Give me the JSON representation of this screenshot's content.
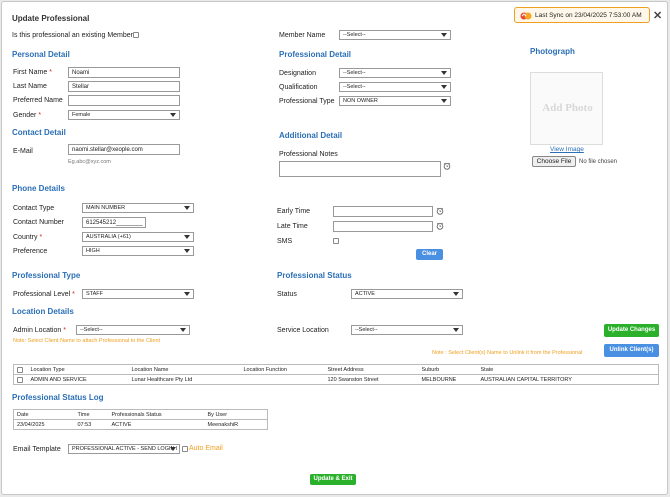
{
  "dialog": {
    "title": "Update Professional",
    "sync_text": "Last Sync on 23/04/2025 7:53:00 AM"
  },
  "existing_member": {
    "label": "Is this professional an existing Member?"
  },
  "member_name": {
    "label": "Member Name",
    "value": "--Select--"
  },
  "personal": {
    "heading": "Personal Detail",
    "first_name_label": "First Name",
    "first_name": "Noami",
    "last_name_label": "Last Name",
    "last_name": "Stellar",
    "preferred_name_label": "Preferred Name",
    "preferred_name": "",
    "gender_label": "Gender",
    "gender": "Female"
  },
  "contact": {
    "heading": "Contact Detail",
    "email_label": "E-Mail",
    "email": "naomi.stellar@xeople.com",
    "email_hint": "Eg.abc@xyz.com"
  },
  "professional": {
    "heading": "Professional Detail",
    "designation_label": "Designation",
    "designation": "--Select--",
    "qualification_label": "Qualification",
    "qualification": "--Select--",
    "type_label": "Professional Type",
    "type": "NON OWNER"
  },
  "photo": {
    "heading": "Photograph",
    "placeholder": "Add Photo",
    "view_link": "View Image",
    "choose_button": "Choose File",
    "no_file": "No file chosen"
  },
  "additional": {
    "heading": "Additional Detail",
    "notes_label": "Professional Notes",
    "notes": ""
  },
  "phone": {
    "heading": "Phone Details",
    "contact_type_label": "Contact Type",
    "contact_type": "MAIN NUMBER",
    "contact_number_label": "Contact Number",
    "contact_number": "612545212________",
    "country_label": "Country",
    "country": "AUSTRALIA (+61)",
    "preference_label": "Preference",
    "preference": "HIGH"
  },
  "timing": {
    "early_time_label": "Early Time",
    "early_time": "",
    "late_time_label": "Late Time",
    "late_time": "",
    "sms_label": "SMS",
    "clear_button": "Clear"
  },
  "prof_type": {
    "heading": "Professional Type",
    "level_label": "Professional Level",
    "level": "STAFF"
  },
  "prof_status": {
    "heading": "Professional Status",
    "status_label": "Status",
    "status": "ACTIVE"
  },
  "location": {
    "heading": "Location Details",
    "admin_label": "Admin Location",
    "admin_value": "--Select--",
    "service_label": "Service Location",
    "service_value": "--Select--",
    "admin_note": "Note: Select Client Name to attach Professional to the Client",
    "unlink_note": "Note : Select Client(s) Name to Unlink it from the Professional",
    "update_button": "Update Changes",
    "unlink_button": "Unlink Client(s)",
    "columns": [
      "Location Type",
      "Location Name",
      "Location Function",
      "Street Address",
      "Suburb",
      "State"
    ],
    "rows": [
      [
        "ADMIN AND SERVICE",
        "Lunar Healthcare Pty Ltd",
        "",
        "120 Swanston Street",
        "MELBOURNE",
        "AUSTRALIAN CAPITAL TERRITORY"
      ]
    ]
  },
  "status_log": {
    "heading": "Professional Status Log",
    "columns": [
      "Date",
      "Time",
      "Professionals Status",
      "By User"
    ],
    "rows": [
      [
        "23/04/2025",
        "07:53",
        "ACTIVE",
        "MeenakshiR"
      ]
    ]
  },
  "email_template": {
    "label": "Email Template",
    "value": "PROFESSIONAL ACTIVE - SEND LOGIN I",
    "auto_label": "Auto Email"
  },
  "footer": {
    "submit_button": "Update & Exit"
  },
  "colors": {
    "section": "#2b6fb6",
    "green": "#2bb02b",
    "blue": "#4a90e2",
    "note": "#f0a020",
    "required": "#d21f1f"
  }
}
